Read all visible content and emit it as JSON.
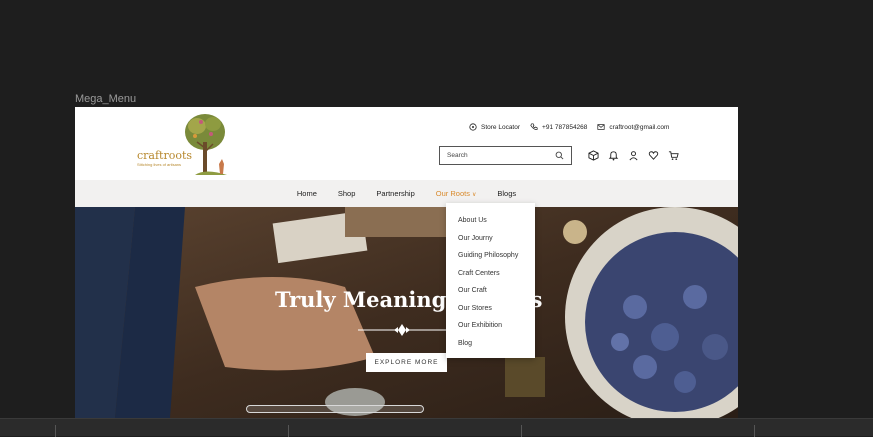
{
  "canvas": {
    "frame_label": "Mega_Menu"
  },
  "brand": {
    "name": "craftroots",
    "tagline": "Stitching lives of artisans"
  },
  "contact": {
    "store_locator": "Store Locator",
    "phone": "+91 787854268",
    "email": "craftroot@gmail.com"
  },
  "search": {
    "placeholder": "Search"
  },
  "nav": {
    "items": [
      {
        "label": "Home"
      },
      {
        "label": "Shop"
      },
      {
        "label": "Partnership"
      },
      {
        "label": "Our Roots",
        "active": true
      },
      {
        "label": "Blogs"
      }
    ]
  },
  "hero": {
    "title": "Truly Meaningful Gifts",
    "cta": "EXPLORE MORE"
  },
  "dropdown": {
    "items": [
      {
        "label": "About Us"
      },
      {
        "label": "Our Journy"
      },
      {
        "label": "Guiding Philosophy"
      },
      {
        "label": "Craft Centers"
      },
      {
        "label": "Our Craft"
      },
      {
        "label": "Our Stores"
      },
      {
        "label": "Our Exhibition"
      },
      {
        "label": "Blog"
      }
    ]
  },
  "colors": {
    "accent": "#d98a2c",
    "brand": "#b7882d"
  }
}
